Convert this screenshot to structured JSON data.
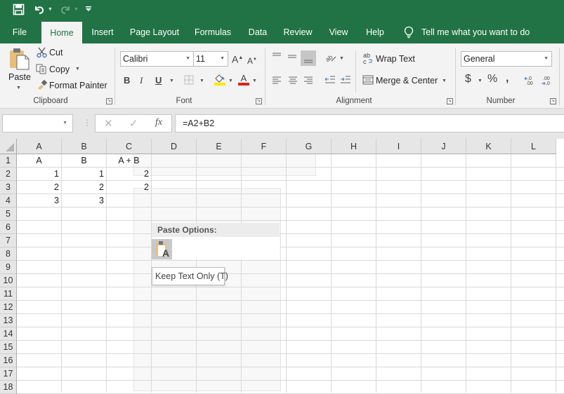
{
  "quick_access": {
    "save_icon": "save-icon",
    "undo_icon": "undo-icon",
    "redo_icon": "redo-icon",
    "customize_icon": "customize-qat-icon"
  },
  "tabs": [
    {
      "label": "File"
    },
    {
      "label": "Home",
      "active": true
    },
    {
      "label": "Insert"
    },
    {
      "label": "Page Layout"
    },
    {
      "label": "Formulas"
    },
    {
      "label": "Data"
    },
    {
      "label": "Review"
    },
    {
      "label": "View"
    },
    {
      "label": "Help"
    }
  ],
  "tell_me": "Tell me what you want to do",
  "ribbon": {
    "clipboard": {
      "label": "Clipboard",
      "paste": "Paste",
      "cut": "Cut",
      "copy": "Copy",
      "format_painter": "Format Painter"
    },
    "font": {
      "label": "Font",
      "font_name": "Calibri",
      "font_size": "11",
      "bold": "B",
      "italic": "I",
      "underline": "U",
      "font_color": "#e0201e",
      "fill_color": "#ffe800"
    },
    "alignment": {
      "label": "Alignment",
      "wrap_text": "Wrap Text",
      "merge_center": "Merge & Center"
    },
    "number": {
      "label": "Number",
      "format": "General",
      "currency": "$",
      "percent": "%",
      "comma": ","
    }
  },
  "formula_bar": {
    "name_box": "",
    "cancel": "✕",
    "enter": "✓",
    "fx": "fx",
    "formula": "=A2+B2"
  },
  "sheet": {
    "columns": [
      "A",
      "B",
      "C",
      "D",
      "E",
      "F",
      "G",
      "H",
      "I",
      "J",
      "K",
      "L"
    ],
    "rows": [
      "1",
      "2",
      "3",
      "4",
      "5",
      "6",
      "7",
      "8",
      "9",
      "10",
      "11",
      "12",
      "13",
      "14",
      "15",
      "16",
      "17",
      "18"
    ],
    "cells": {
      "A1": "A",
      "B1": "B",
      "C1": "A + B",
      "A2": "1",
      "B2": "1",
      "C2": "2",
      "A3": "2",
      "B3": "2",
      "C3": "2",
      "A4": "3",
      "B4": "3"
    }
  },
  "paste_options": {
    "title": "Paste Options:",
    "tooltip": "Keep Text Only (T)"
  }
}
